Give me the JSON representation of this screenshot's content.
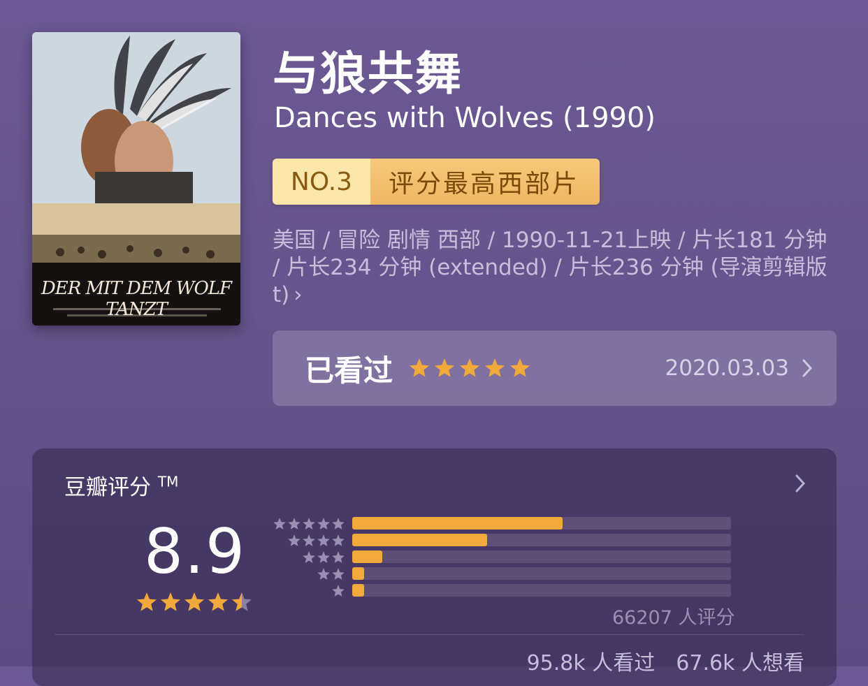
{
  "movie": {
    "title_cn": "与狼共舞",
    "title_en": "Dances with Wolves (1990)",
    "poster_text": "DER MIT DEM WOLF TANZT",
    "rank": {
      "number": "NO.3",
      "label": "评分最高西部片"
    },
    "meta": "美国 / 冒险 剧情 西部 / 1990-11-21上映 / 片长181 分钟 / 片长234 分钟 (extended) / 片长236 分钟 (导演剪辑版 t)"
  },
  "watched": {
    "label": "已看过",
    "stars": 5,
    "date": "2020.03.03"
  },
  "rating": {
    "title": "豆瓣评分",
    "tm": "TM",
    "score": "8.9",
    "score_stars": 4.5,
    "distribution": [
      {
        "stars": 5,
        "fraction": 0.555
      },
      {
        "stars": 4,
        "fraction": 0.357
      },
      {
        "stars": 3,
        "fraction": 0.08
      },
      {
        "stars": 2,
        "fraction": 0.032
      },
      {
        "stars": 1,
        "fraction": 0.032
      }
    ],
    "total": "66207 人评分",
    "watched_count": "95.8k 人看过",
    "want_count": "67.6k 人想看"
  },
  "icons": {
    "star": "star-icon",
    "chevron": "chevron-right-icon"
  },
  "colors": {
    "accent": "#f2a93b",
    "background": "#66548d"
  }
}
